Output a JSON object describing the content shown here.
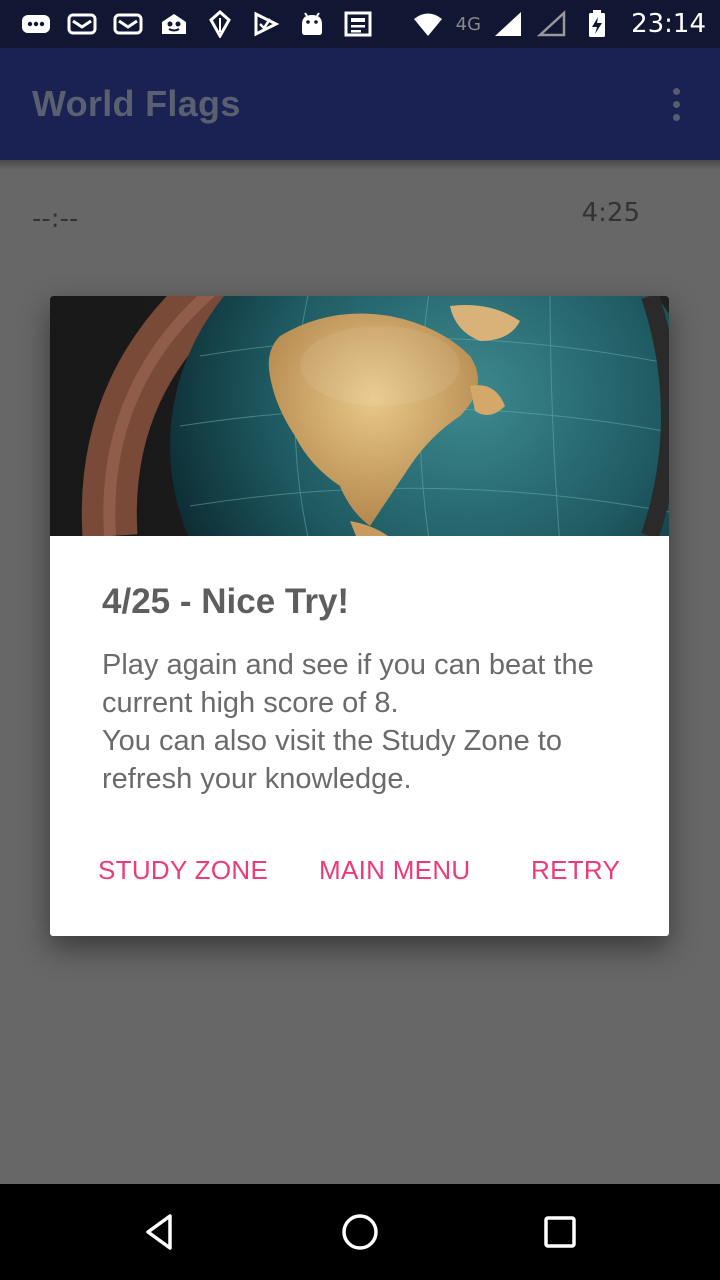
{
  "status_bar": {
    "icons": [
      "chat-icon",
      "mail-icon",
      "mail-icon",
      "game-icon",
      "leaf-icon",
      "check-icon",
      "android-icon",
      "news-icon",
      "wifi-icon",
      "signal-icon",
      "signal-empty-icon",
      "battery-charging-icon"
    ],
    "network": "4G",
    "time": "23:14"
  },
  "app_bar": {
    "title": "World Flags"
  },
  "game": {
    "timer": "--:--",
    "score": "4:25"
  },
  "dialog": {
    "image": "globe-photo",
    "title": "4/25 - Nice Try!",
    "message_line1": "Play again and see if you can beat the current high score of 8.",
    "message_line2": "You can also visit the Study Zone to refresh your knowledge.",
    "buttons": {
      "study": "STUDY ZONE",
      "menu": "MAIN MENU",
      "retry": "RETRY"
    }
  },
  "colors": {
    "accent": "#ef3a7a",
    "app_bar": "#1a2254",
    "status_bar": "#111633",
    "dim_background": "#676767"
  }
}
